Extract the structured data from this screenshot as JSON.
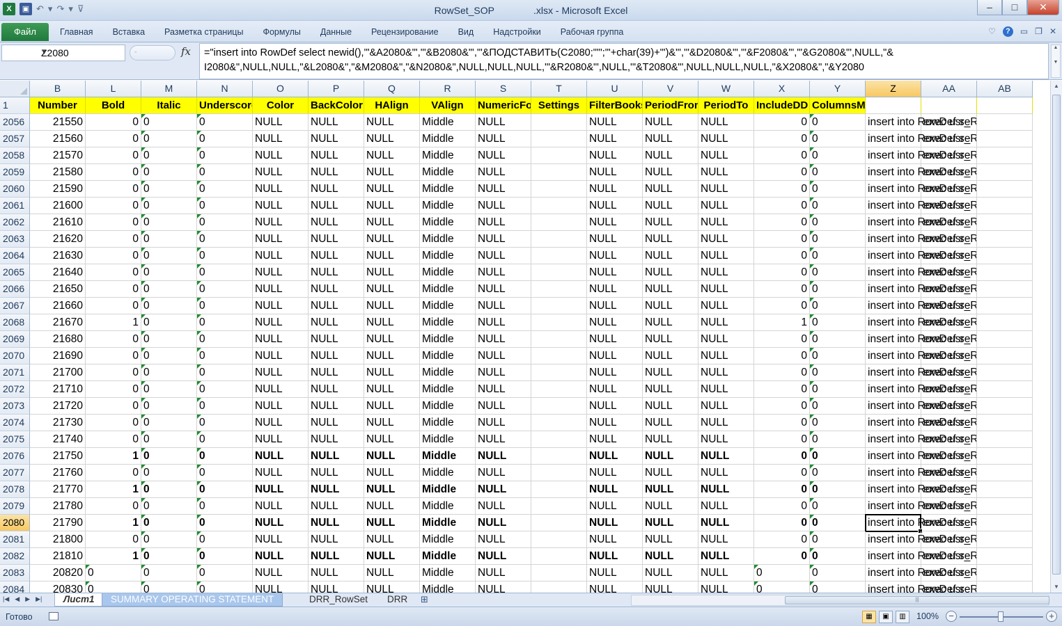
{
  "window": {
    "title": "RowSet_SOP    .xlsx - Microsoft Excel",
    "min": "–",
    "max": "□",
    "close": "✕"
  },
  "ribbon": {
    "file": "Файл",
    "tabs": [
      "Главная",
      "Вставка",
      "Разметка страницы",
      "Формулы",
      "Данные",
      "Рецензирование",
      "Вид",
      "Надстройки",
      "Рабочая группа"
    ]
  },
  "formula_bar": {
    "name_box": "Z2080",
    "fx": "fx",
    "line1": "=\"insert into RowDef select newid(),'\"&A2080&\"','\"&B2080&\"','\"&ПОДСТАВИТЬ(C2080;\"'\";\"'+char(39)+'\")&\"','\"&D2080&\"','\"&F2080&\"','\"&G2080&\"',NULL,\"&",
    "line2": "I2080&\",NULL,NULL,\"&L2080&\",\"&M2080&\",\"&N2080&\",NULL,NULL,NULL,'\"&R2080&\"',NULL,'\"&T2080&\"',NULL,NULL,NULL,\"&X2080&\",\"&Y2080"
  },
  "columns": [
    {
      "letter": "B",
      "header": "Number"
    },
    {
      "letter": "L",
      "header": "Bold"
    },
    {
      "letter": "M",
      "header": "Italic"
    },
    {
      "letter": "N",
      "header": "Underscore"
    },
    {
      "letter": "O",
      "header": "Color"
    },
    {
      "letter": "P",
      "header": "BackColor"
    },
    {
      "letter": "Q",
      "header": "HAlign"
    },
    {
      "letter": "R",
      "header": "VAlign"
    },
    {
      "letter": "S",
      "header": "NumericFormat"
    },
    {
      "letter": "T",
      "header": "Settings"
    },
    {
      "letter": "U",
      "header": "FilterBooks"
    },
    {
      "letter": "V",
      "header": "PeriodFrom"
    },
    {
      "letter": "W",
      "header": "PeriodTo"
    },
    {
      "letter": "X",
      "header": "IncludeDD"
    },
    {
      "letter": "Y",
      "header": "ColumnsMerge"
    },
    {
      "letter": "Z",
      "header": ""
    },
    {
      "letter": "AA",
      "header": ""
    },
    {
      "letter": "AB",
      "header": ""
    }
  ],
  "header_row_number": "1",
  "rows": [
    {
      "n": "2056",
      "number": "21550",
      "bold": "0",
      "x": "0",
      "b": false
    },
    {
      "n": "2057",
      "number": "21560",
      "bold": "0",
      "x": "0",
      "b": false
    },
    {
      "n": "2058",
      "number": "21570",
      "bold": "0",
      "x": "0",
      "b": false
    },
    {
      "n": "2059",
      "number": "21580",
      "bold": "0",
      "x": "0",
      "b": false
    },
    {
      "n": "2060",
      "number": "21590",
      "bold": "0",
      "x": "0",
      "b": false
    },
    {
      "n": "2061",
      "number": "21600",
      "bold": "0",
      "x": "0",
      "b": false
    },
    {
      "n": "2062",
      "number": "21610",
      "bold": "0",
      "x": "0",
      "b": false
    },
    {
      "n": "2063",
      "number": "21620",
      "bold": "0",
      "x": "0",
      "b": false
    },
    {
      "n": "2064",
      "number": "21630",
      "bold": "0",
      "x": "0",
      "b": false
    },
    {
      "n": "2065",
      "number": "21640",
      "bold": "0",
      "x": "0",
      "b": false
    },
    {
      "n": "2066",
      "number": "21650",
      "bold": "0",
      "x": "0",
      "b": false
    },
    {
      "n": "2067",
      "number": "21660",
      "bold": "0",
      "x": "0",
      "b": false
    },
    {
      "n": "2068",
      "number": "21670",
      "bold": "1",
      "x": "1",
      "b": false
    },
    {
      "n": "2069",
      "number": "21680",
      "bold": "0",
      "x": "0",
      "b": false
    },
    {
      "n": "2070",
      "number": "21690",
      "bold": "0",
      "x": "0",
      "b": false
    },
    {
      "n": "2071",
      "number": "21700",
      "bold": "0",
      "x": "0",
      "b": false
    },
    {
      "n": "2072",
      "number": "21710",
      "bold": "0",
      "x": "0",
      "b": false
    },
    {
      "n": "2073",
      "number": "21720",
      "bold": "0",
      "x": "0",
      "b": false
    },
    {
      "n": "2074",
      "number": "21730",
      "bold": "0",
      "x": "0",
      "b": false
    },
    {
      "n": "2075",
      "number": "21740",
      "bold": "0",
      "x": "0",
      "b": false
    },
    {
      "n": "2076",
      "number": "21750",
      "bold": "1",
      "x": "0",
      "b": true
    },
    {
      "n": "2077",
      "number": "21760",
      "bold": "0",
      "x": "0",
      "b": false
    },
    {
      "n": "2078",
      "number": "21770",
      "bold": "1",
      "x": "0",
      "b": true
    },
    {
      "n": "2079",
      "number": "21780",
      "bold": "0",
      "x": "0",
      "b": false
    },
    {
      "n": "2080",
      "number": "21790",
      "bold": "1",
      "x": "0",
      "b": true
    },
    {
      "n": "2081",
      "number": "21800",
      "bold": "0",
      "x": "0",
      "b": false
    },
    {
      "n": "2082",
      "number": "21810",
      "bold": "1",
      "x": "0",
      "b": true
    },
    {
      "n": "2083",
      "number": "20820",
      "bold": "0",
      "x": "0",
      "b": false,
      "text": true
    },
    {
      "n": "2084",
      "number": "20830",
      "bold": "0",
      "x": "0",
      "b": false,
      "text": true
    }
  ],
  "fixed_values": {
    "italic": "0",
    "underscore": "0",
    "null": "NULL",
    "valign": "Middle",
    "y": "0",
    "z": "insert into RowDef se",
    "aa": "exec usr_Row"
  },
  "selected_row": "2080",
  "selected_col": "Z",
  "sheets": [
    "Лист1",
    "SUMMARY OPERATING STATEMENT",
    "DRR_RowSet",
    "DRR"
  ],
  "status": {
    "ready": "Готово",
    "zoom": "100%"
  },
  "colors": {
    "header_fill": "#ffff00",
    "error_triangle": "#1e8e2e",
    "file_tab": "#1f7a3d"
  }
}
